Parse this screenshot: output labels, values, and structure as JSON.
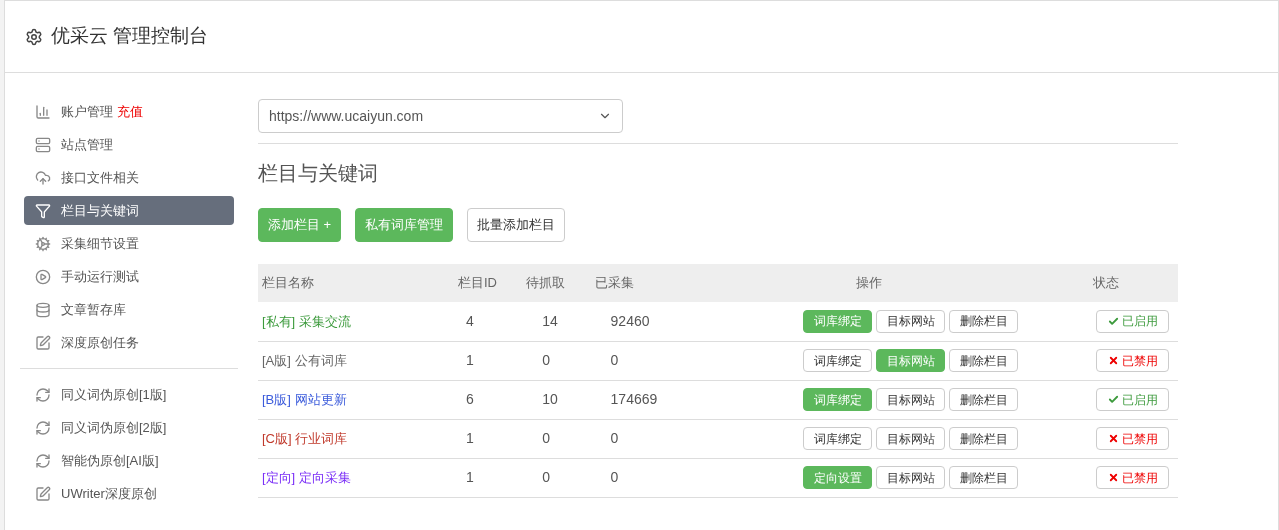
{
  "header": {
    "title": "优采云 管理控制台"
  },
  "sidebar": {
    "items": [
      {
        "kind": "chart",
        "label": "账户管理",
        "extra": "充值",
        "selected": false
      },
      {
        "kind": "server",
        "label": "站点管理",
        "selected": false
      },
      {
        "kind": "cloud",
        "label": "接口文件相关",
        "selected": false
      },
      {
        "kind": "filter",
        "label": "栏目与关键词",
        "selected": true
      },
      {
        "kind": "gears",
        "label": "采集细节设置",
        "selected": false
      },
      {
        "kind": "play",
        "label": "手动运行测试",
        "selected": false
      },
      {
        "kind": "database",
        "label": "文章暂存库",
        "selected": false
      },
      {
        "kind": "edit",
        "label": "深度原创任务",
        "selected": false
      },
      {
        "kind": "divider"
      },
      {
        "kind": "refresh",
        "label": "同义词伪原创[1版]",
        "selected": false
      },
      {
        "kind": "refresh",
        "label": "同义词伪原创[2版]",
        "selected": false
      },
      {
        "kind": "refresh",
        "label": "智能伪原创[AI版]",
        "selected": false
      },
      {
        "kind": "edit",
        "label": "UWriter深度原创",
        "selected": false
      }
    ]
  },
  "site_select": {
    "value": "https://www.ucaiyun.com"
  },
  "heading": "栏目与关键词",
  "toolbar": [
    {
      "label": "添加栏目 +",
      "primary": true
    },
    {
      "label": "私有词库管理",
      "primary": true
    },
    {
      "label": "批量添加栏目",
      "primary": false
    }
  ],
  "table": {
    "columns": [
      "栏目名称",
      "栏目ID",
      "待抓取",
      "已采集",
      "操作",
      "状态"
    ],
    "rows": [
      {
        "tag": "[私有]",
        "name": "采集交流",
        "color": "#3c9a3c",
        "id": "4",
        "pending": "14",
        "collected": "92460",
        "actions": [
          {
            "label": "词库绑定",
            "highlighted": true
          },
          {
            "label": "目标网站",
            "highlighted": false
          },
          {
            "label": "删除栏目",
            "highlighted": false
          }
        ],
        "enabled": true,
        "status": "已启用"
      },
      {
        "tag": "[A版]",
        "name": "公有词库",
        "color": "#666666",
        "id": "1",
        "pending": "0",
        "collected": "0",
        "actions": [
          {
            "label": "词库绑定",
            "highlighted": false
          },
          {
            "label": "目标网站",
            "highlighted": true
          },
          {
            "label": "删除栏目",
            "highlighted": false
          }
        ],
        "enabled": false,
        "status": "已禁用"
      },
      {
        "tag": "[B版]",
        "name": "网站更新",
        "color": "#3b5bdb",
        "id": "6",
        "pending": "10",
        "collected": "174669",
        "actions": [
          {
            "label": "词库绑定",
            "highlighted": true
          },
          {
            "label": "目标网站",
            "highlighted": false
          },
          {
            "label": "删除栏目",
            "highlighted": false
          }
        ],
        "enabled": true,
        "status": "已启用"
      },
      {
        "tag": "[C版]",
        "name": "行业词库",
        "color": "#c0392b",
        "id": "1",
        "pending": "0",
        "collected": "0",
        "actions": [
          {
            "label": "词库绑定",
            "highlighted": false
          },
          {
            "label": "目标网站",
            "highlighted": false
          },
          {
            "label": "删除栏目",
            "highlighted": false
          }
        ],
        "enabled": false,
        "status": "已禁用"
      },
      {
        "tag": "[定向]",
        "name": "定向采集",
        "color": "#7b2ff7",
        "id": "1",
        "pending": "0",
        "collected": "0",
        "actions": [
          {
            "label": "定向设置",
            "highlighted": true
          },
          {
            "label": "目标网站",
            "highlighted": false
          },
          {
            "label": "删除栏目",
            "highlighted": false
          }
        ],
        "enabled": false,
        "status": "已禁用"
      }
    ]
  }
}
